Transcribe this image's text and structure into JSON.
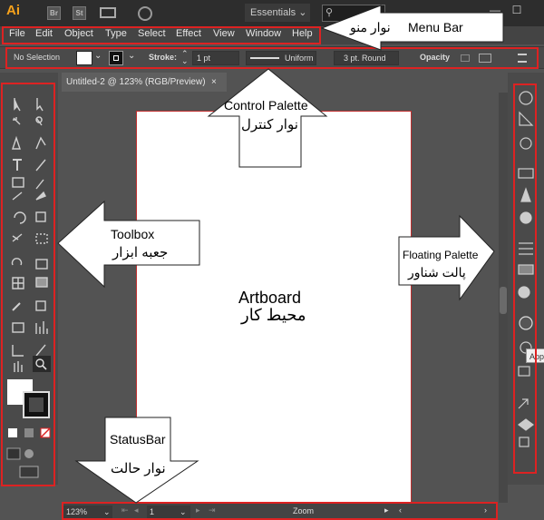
{
  "title_bar": {
    "logo": "Ai",
    "br_chip": "Br",
    "st_chip": "St",
    "workspace": "Essentials"
  },
  "menu": [
    "File",
    "Edit",
    "Object",
    "Type",
    "Select",
    "Effect",
    "View",
    "Window",
    "Help"
  ],
  "control": {
    "selection": "No Selection",
    "stroke_label": "Stroke:",
    "stroke_value": "1 pt",
    "uniform": "Uniform",
    "brush": "3 pt. Round",
    "opacity": "Opacity"
  },
  "document_tab": {
    "title": "Untitled-2 @ 123% (RGB/Preview)",
    "close": "×"
  },
  "status_bar": {
    "zoom": "123%",
    "page": "1",
    "tool": "Zoom"
  },
  "tooltip": "Appe",
  "annotations": {
    "menu_bar_en": "Menu Bar",
    "menu_bar_fa": "نوار منو",
    "control_en": "Control Palette",
    "control_fa": "نوار کنترل",
    "toolbox_en": "Toolbox",
    "toolbox_fa": "جعبه ابزار",
    "floating_en": "Floating Palette",
    "floating_fa": "پالت شناور",
    "artboard_en": "Artboard",
    "artboard_fa": "محیط کار",
    "status_en": "StatusBar",
    "status_fa": "نوار حالت"
  },
  "colors": {
    "annotation_outline": "#dd2222",
    "app_background": "#535353",
    "logo": "#f7a21b"
  }
}
